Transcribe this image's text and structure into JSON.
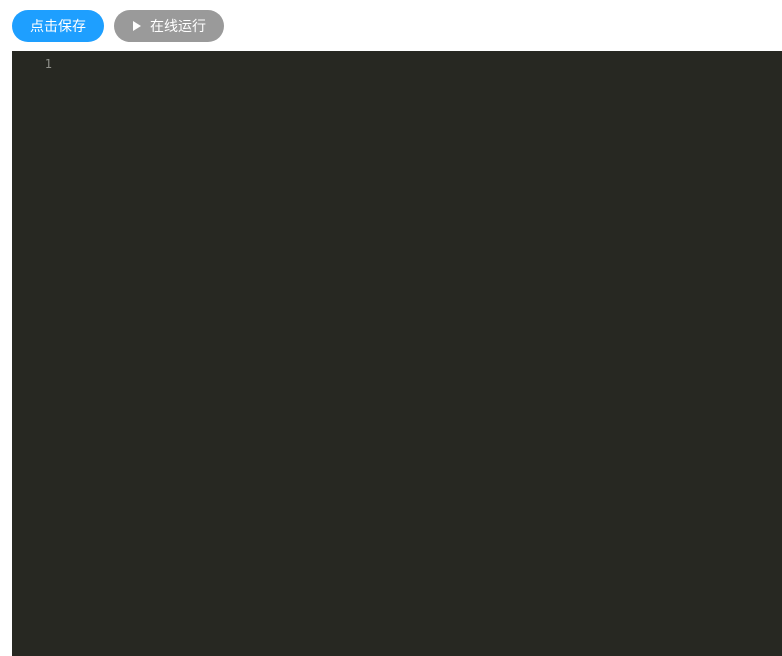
{
  "toolbar": {
    "save_label": "点击保存",
    "run_label": "在线运行"
  },
  "editor": {
    "line_numbers": [
      "1"
    ],
    "lines": [
      ""
    ]
  }
}
